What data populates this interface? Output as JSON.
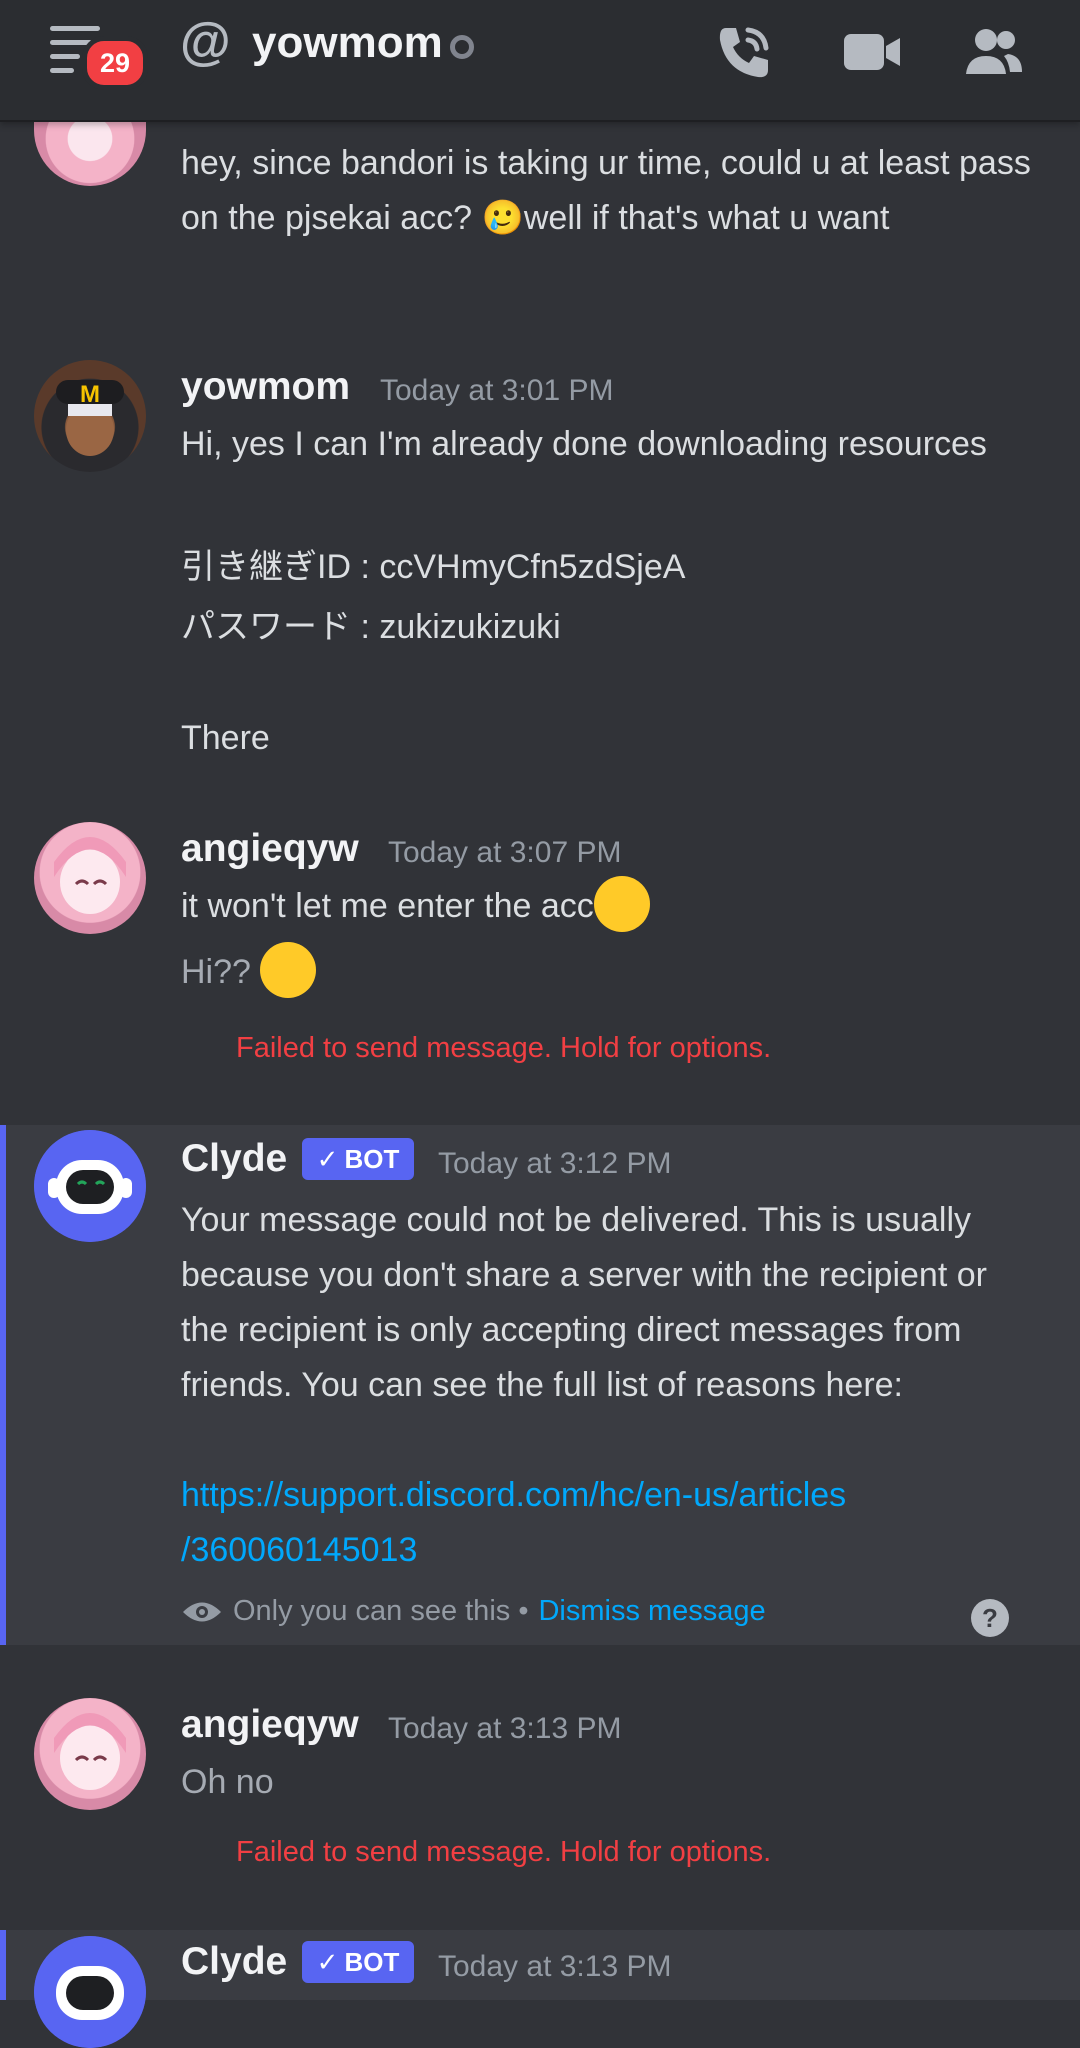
{
  "header": {
    "at_symbol": "@",
    "title": "yowmom",
    "badge_count": "29"
  },
  "messages": {
    "partial": {
      "text": "hey, since bandori is taking ur time, could u at least pass on the pjsekai acc? 🥲well if that's what u want"
    },
    "yowmom": {
      "username": "yowmom",
      "time": "Today at 3:01 PM",
      "line1": "Hi, yes I can I'm already done downloading resources",
      "line2": "引き継ぎID : ccVHmyCfn5zdSjeA",
      "line3": "パスワード : zukizukizuki",
      "line4": "There"
    },
    "angie1": {
      "username": "angieqyw",
      "time": "Today at 3:07 PM",
      "line1": "it won't let me enter the acc",
      "line2": "Hi??",
      "failed": "Failed to send message. Hold for options."
    },
    "clyde1": {
      "username": "Clyde",
      "bot": "BOT",
      "time": "Today at 3:12 PM",
      "body": "Your message could not be delivered. This is usually because you don't share a server with the recipient or the recipient is only accepting direct messages from friends. You can see the full list of reasons here:",
      "link1": "https://support.discord.com/hc/en-us/articles",
      "link2": "/360060145013",
      "only_you": "Only you can see this •",
      "dismiss": "Dismiss message",
      "help": "?"
    },
    "angie2": {
      "username": "angieqyw",
      "time": "Today at 3:13 PM",
      "line1": "Oh no",
      "failed": "Failed to send message. Hold for options."
    },
    "clyde2": {
      "username": "Clyde",
      "bot": "BOT",
      "time": "Today at 3:13 PM"
    }
  },
  "colors": {
    "accent": "#5865f2",
    "error": "#f23f43",
    "link": "#00a8fc",
    "background": "#313338"
  }
}
